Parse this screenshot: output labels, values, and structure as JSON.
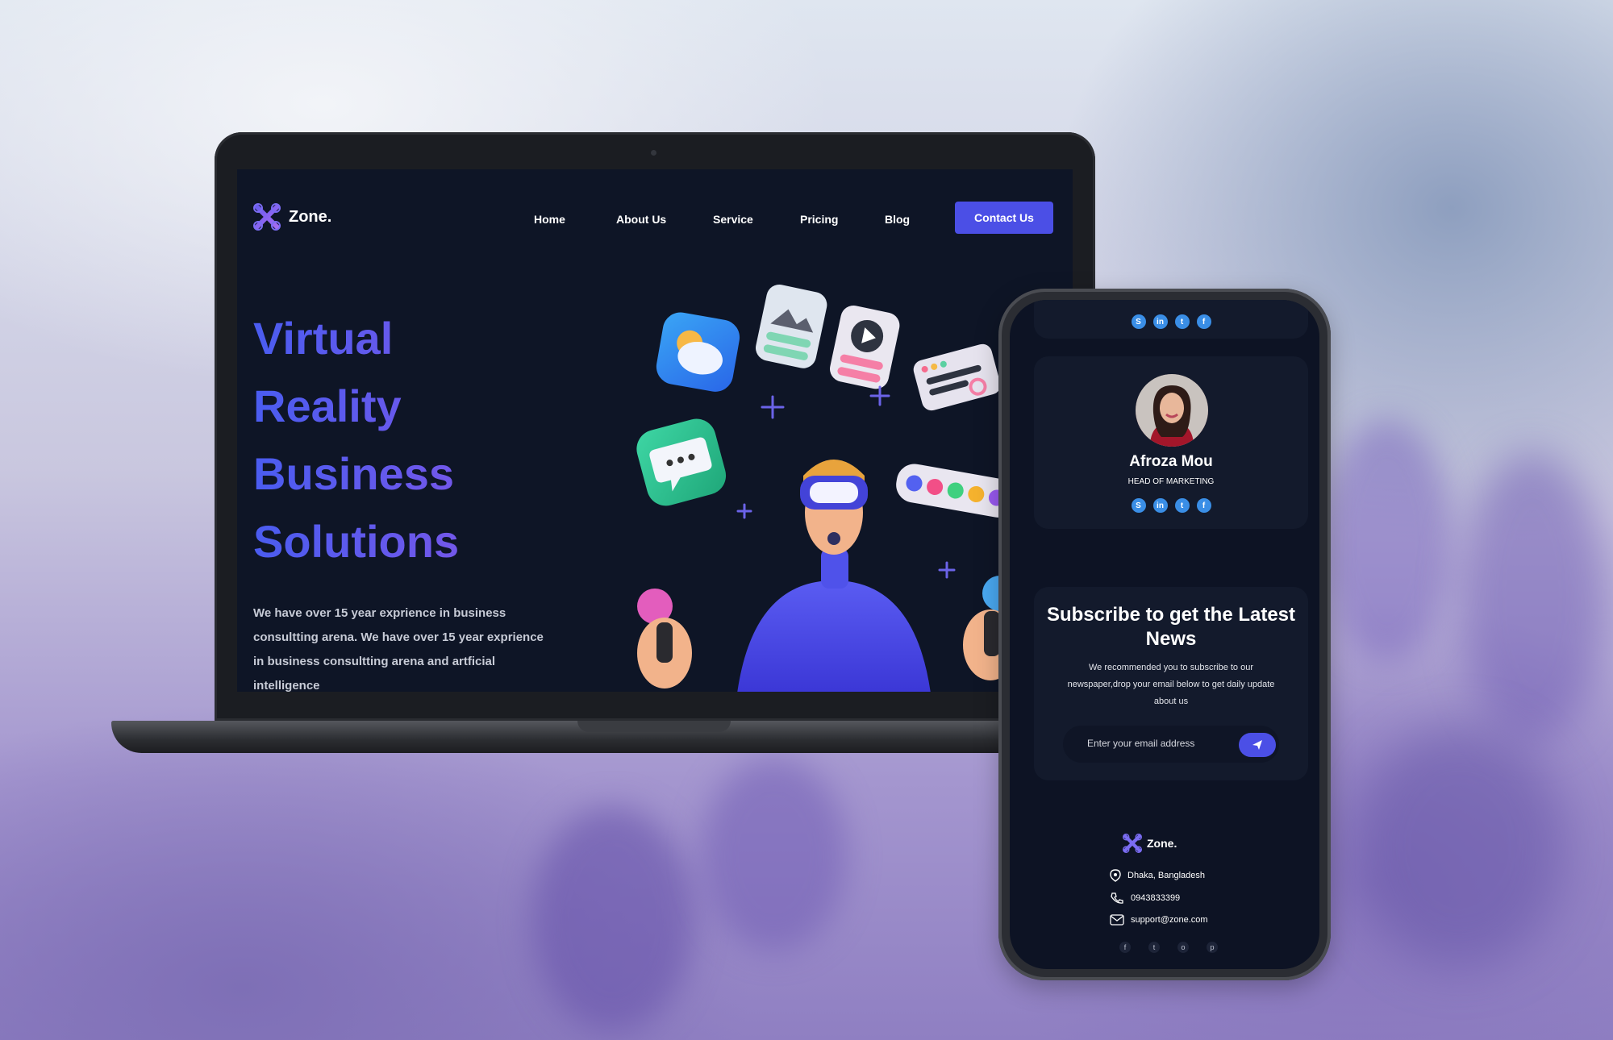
{
  "laptop": {
    "brand": "Zone.",
    "nav": [
      "Home",
      "About Us",
      "Service",
      "Pricing",
      "Blog"
    ],
    "cta": "Contact Us",
    "hero_lines": [
      "Virtual",
      "Reality",
      "Business",
      "Solutions"
    ],
    "hero_desc": "We have over 15 year exprience in business consultting arena. We have over 15 year exprience in business consultting arena and artficial intelligence"
  },
  "phone": {
    "top_socials": [
      "S",
      "in",
      "t",
      "f"
    ],
    "team_member": {
      "name": "Afroza Mou",
      "role": "HEAD OF MARKETING",
      "socials": [
        "S",
        "in",
        "t",
        "f"
      ]
    },
    "subscribe": {
      "title": "Subscribe to get the Latest News",
      "desc": "We recommended you to subscribe to our newspaper,drop your email below to get daily update about us",
      "placeholder": "Enter your email address"
    },
    "footer": {
      "brand": "Zone.",
      "address": "Dhaka, Bangladesh",
      "phone": "0943833399",
      "email": "support@zone.com",
      "socials": [
        "f",
        "t",
        "o",
        "p"
      ]
    }
  },
  "colors": {
    "accent": "#4b4fe6",
    "bg_dark": "#0e1526",
    "card": "#131a2c"
  }
}
